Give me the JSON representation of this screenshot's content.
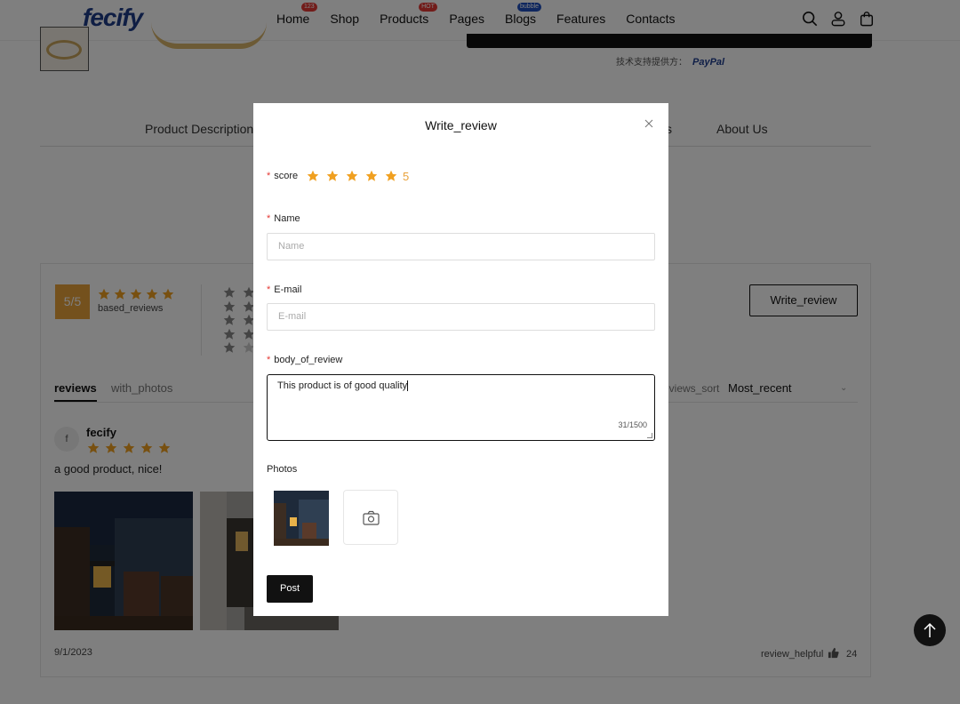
{
  "header": {
    "logo": "fecify",
    "nav": [
      {
        "label": "Home",
        "badge": "123",
        "badge_color": "#e53935"
      },
      {
        "label": "Shop",
        "badge": "",
        "badge_color": ""
      },
      {
        "label": "Products",
        "badge": "HOT",
        "badge_color": "#e53935"
      },
      {
        "label": "Pages",
        "badge": "",
        "badge_color": ""
      },
      {
        "label": "Blogs",
        "badge": "bubble",
        "badge_color": "#1e4fbf"
      },
      {
        "label": "Features",
        "badge": "",
        "badge_color": ""
      },
      {
        "label": "Contacts",
        "badge": "",
        "badge_color": ""
      }
    ],
    "icons": [
      "search-icon",
      "user-icon",
      "bag-icon"
    ]
  },
  "product": {
    "paypal_note": "技术支持提供方：",
    "paypal_brand": "PayPal"
  },
  "product_tabs": {
    "description": "Product Description",
    "partial": "s",
    "about": "About Us"
  },
  "reviews": {
    "score_badge": "5/5",
    "based_label": "based_reviews",
    "write_button": "Write_review",
    "tabs": {
      "reviews": "reviews",
      "with_photos": "with_photos"
    },
    "sort_label": "eviews_sort",
    "sort_value": "Most_recent",
    "item": {
      "avatar_letter": "f",
      "author": "fecify",
      "rating": 5,
      "text": "a good product, nice!",
      "date": "9/1/2023",
      "helpful_label": "review_helpful",
      "helpful_count": "24"
    }
  },
  "modal": {
    "title": "Write_review",
    "score_label": "score",
    "score_value": "5",
    "name_label": "Name",
    "name_placeholder": "Name",
    "email_label": "E-mail",
    "email_placeholder": "E-mail",
    "body_label": "body_of_review",
    "body_value": "This product is of good quality",
    "body_counter": "31/1500",
    "photos_label": "Photos",
    "post_button": "Post"
  },
  "colors": {
    "accent_star": "#f0a020",
    "score_badge": "#e9a23b",
    "required": "#e53935",
    "primary_dark": "#111111"
  }
}
